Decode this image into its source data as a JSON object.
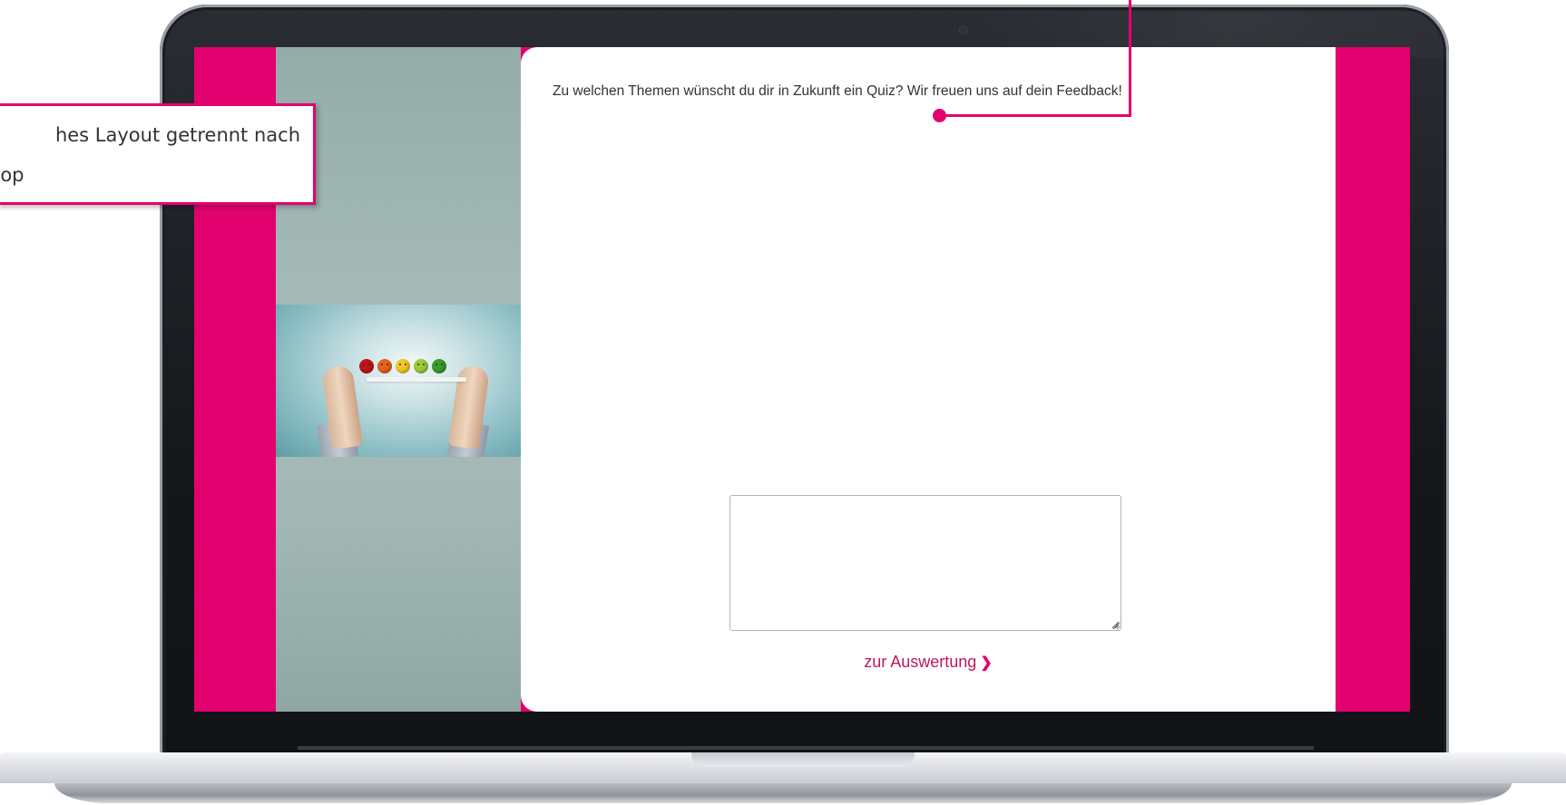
{
  "callout": {
    "line1": "hes Layout getrennt nach",
    "line2": "sktop"
  },
  "quiz": {
    "question": "Zu welchen Themen wünscht du dir in Zukunft ein Quiz? Wir freuen uns auf dein Feedback!",
    "answer_value": "",
    "next_label": "zur Auswertung",
    "next_icon": "chevron-right-icon"
  },
  "colors": {
    "accent": "#e3006f",
    "link": "#c2185b",
    "sidebar": "#9fb5b2",
    "text": "#333333"
  },
  "image": {
    "description_icon": "feedback-smileys-photo",
    "smileys": [
      "red",
      "orange",
      "yellow",
      "light-green",
      "green"
    ]
  }
}
